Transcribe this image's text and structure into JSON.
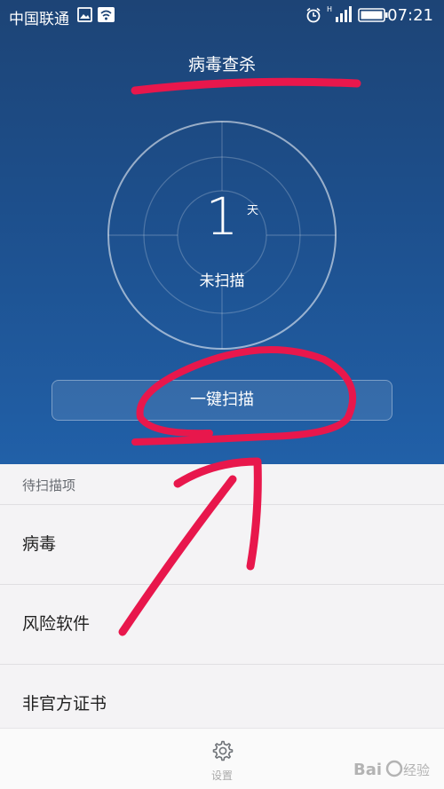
{
  "status_bar": {
    "carrier": "中国联通",
    "time": "07:21",
    "icons": [
      "image-icon",
      "wifi-icon",
      "alarm-icon",
      "signal-icon",
      "battery-icon"
    ]
  },
  "header": {
    "title": "病毒查杀"
  },
  "scan_status": {
    "days": "1",
    "unit": "天",
    "caption": "未扫描"
  },
  "actions": {
    "scan_button_label": "一键扫描"
  },
  "pending_items": {
    "header": "待扫描项",
    "items": [
      {
        "label": "病毒"
      },
      {
        "label": "风险软件"
      },
      {
        "label": "非官方证书"
      }
    ]
  },
  "bottom_bar": {
    "icon": "settings-gear-icon",
    "label": "设置"
  },
  "watermark": "Baidu 经验",
  "colors": {
    "hero_top": "#1d4476",
    "hero_bottom": "#2160a8",
    "annotation_red": "#e8174c"
  }
}
